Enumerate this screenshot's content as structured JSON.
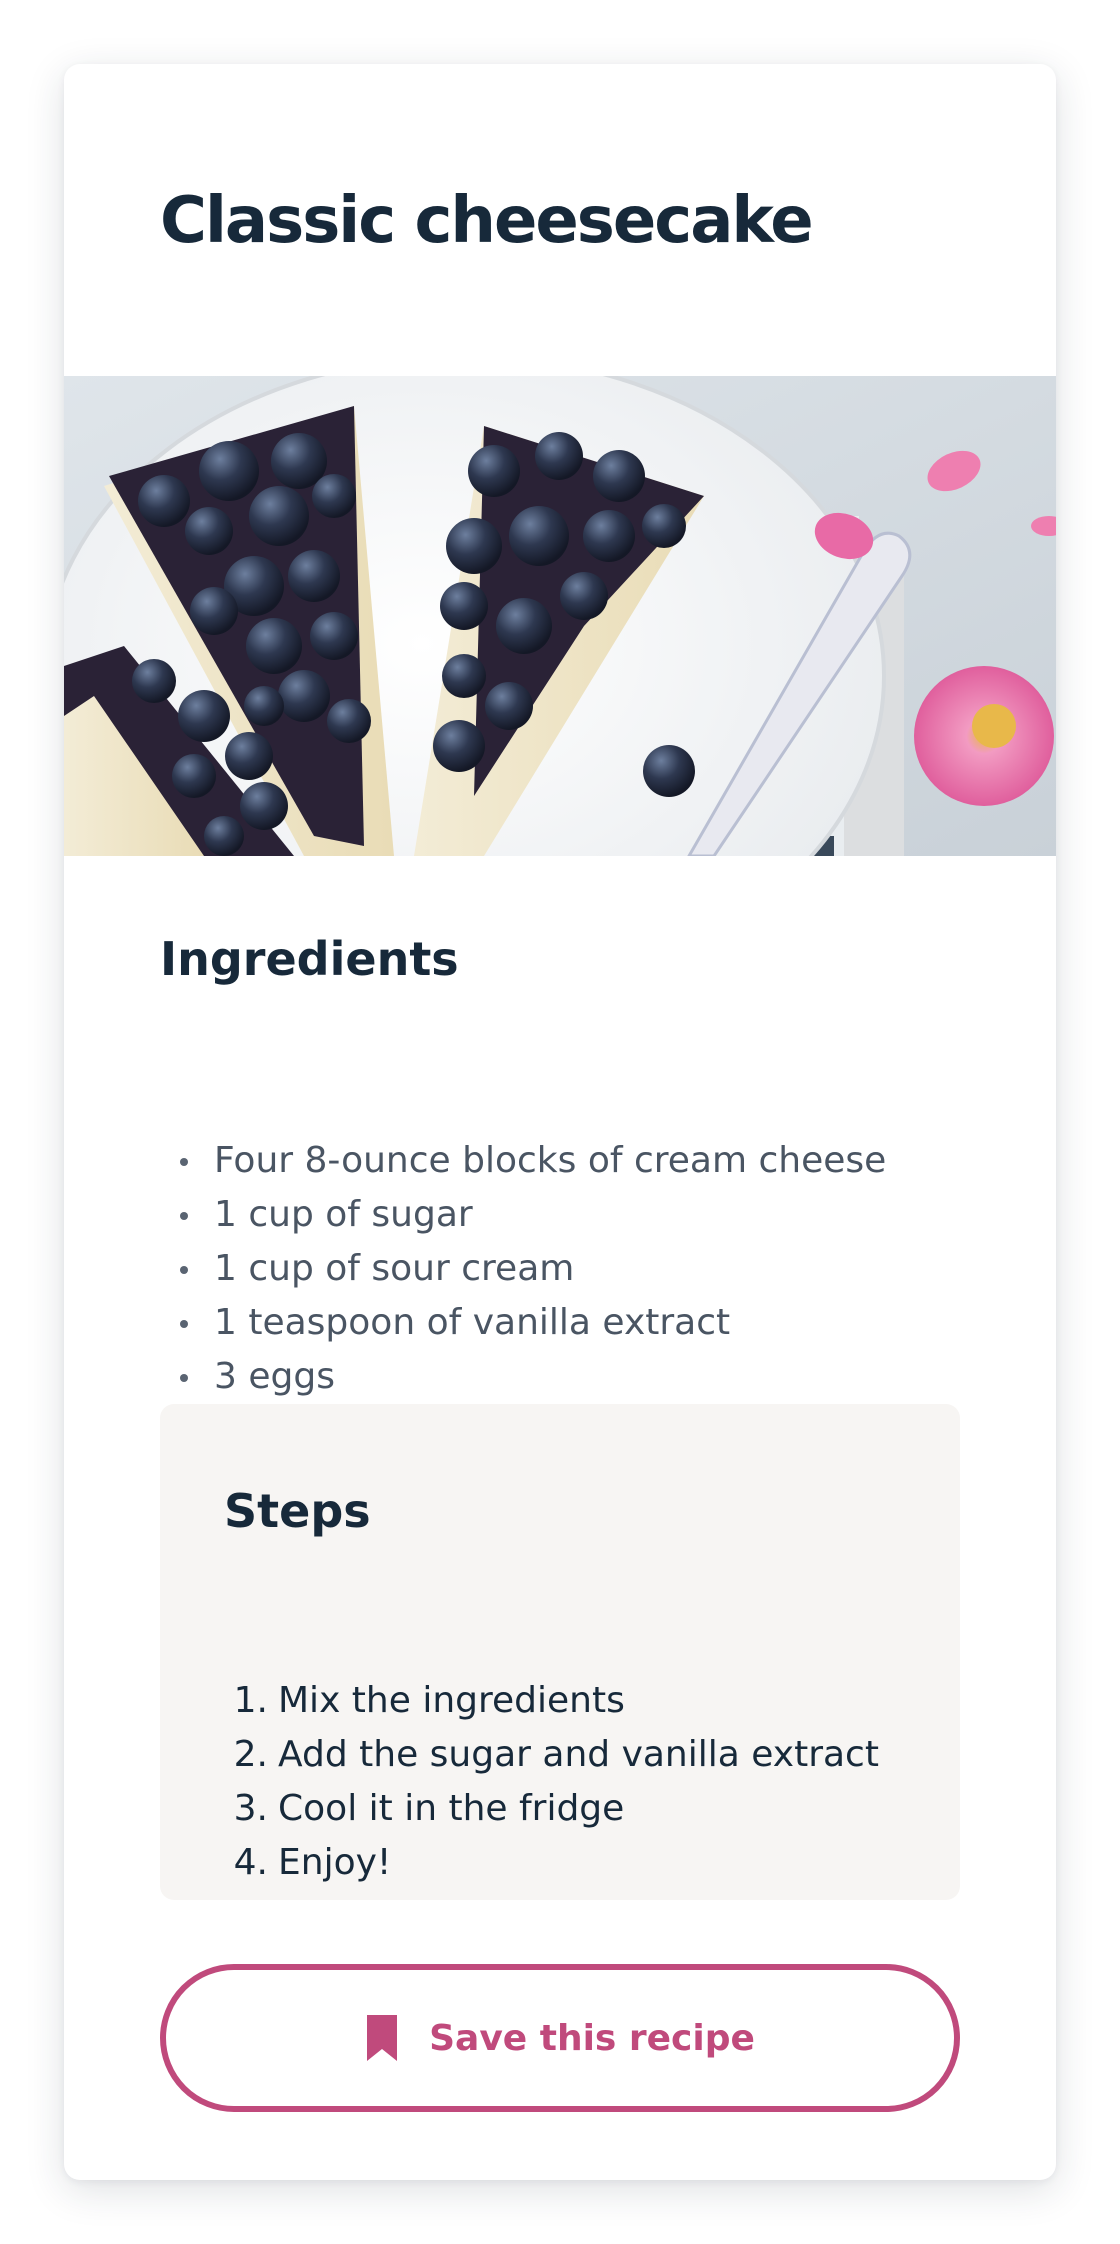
{
  "recipe": {
    "title": "Classic cheesecake",
    "hero_image": "blueberry-cheesecake-slices-on-plate"
  },
  "ingredients": {
    "heading": "Ingredients",
    "items": [
      "Four 8-ounce blocks of cream cheese",
      "1 cup of sugar",
      "1 cup of sour cream",
      "1 teaspoon of vanilla extract",
      "3 eggs"
    ]
  },
  "steps": {
    "heading": "Steps",
    "items": [
      {
        "num": "1.",
        "text": "Mix the ingredients"
      },
      {
        "num": "2.",
        "text": "Add the sugar and vanilla extract"
      },
      {
        "num": "3.",
        "text": "Cool it in the fridge"
      },
      {
        "num": "4.",
        "text": "Enjoy!"
      }
    ]
  },
  "save": {
    "label": "Save this recipe",
    "icon": "bookmark-icon"
  },
  "colors": {
    "heading": "#17293a",
    "body_text": "#4a5563",
    "accent": "#c04a7c",
    "steps_bg": "#f7f5f3"
  }
}
